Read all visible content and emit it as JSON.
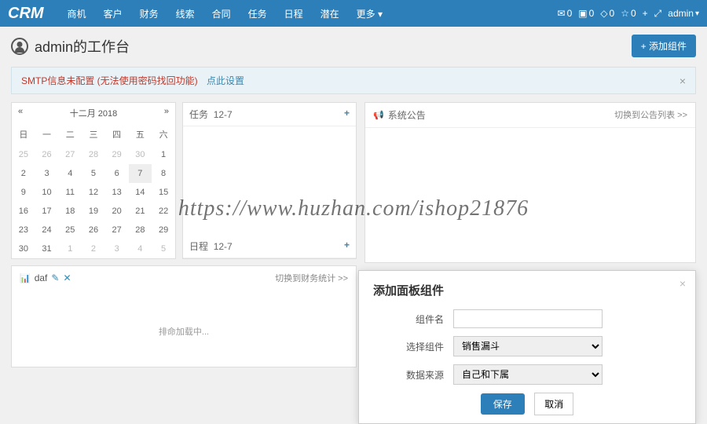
{
  "brand": "CRM",
  "nav": [
    "商机",
    "客户",
    "财务",
    "线索",
    "合同",
    "任务",
    "日程",
    "潜在",
    "更多"
  ],
  "topRight": {
    "mail": "0",
    "chat": "0",
    "diamond": "0",
    "star": "0",
    "user": "admin"
  },
  "page": {
    "title": "admin的工作台",
    "addWidget": "+ 添加组件"
  },
  "alert": {
    "text": "SMTP信息未配置 (无法使用密码找回功能)",
    "link": "点此设置"
  },
  "calendar": {
    "title": "十二月 2018",
    "dow": [
      "日",
      "一",
      "二",
      "三",
      "四",
      "五",
      "六"
    ],
    "weeks": [
      [
        {
          "d": "25",
          "o": true
        },
        {
          "d": "26",
          "o": true
        },
        {
          "d": "27",
          "o": true
        },
        {
          "d": "28",
          "o": true
        },
        {
          "d": "29",
          "o": true
        },
        {
          "d": "30",
          "o": true
        },
        {
          "d": "1"
        }
      ],
      [
        {
          "d": "2"
        },
        {
          "d": "3"
        },
        {
          "d": "4"
        },
        {
          "d": "5"
        },
        {
          "d": "6"
        },
        {
          "d": "7",
          "t": true
        },
        {
          "d": "8"
        }
      ],
      [
        {
          "d": "9"
        },
        {
          "d": "10"
        },
        {
          "d": "11"
        },
        {
          "d": "12"
        },
        {
          "d": "13"
        },
        {
          "d": "14"
        },
        {
          "d": "15"
        }
      ],
      [
        {
          "d": "16"
        },
        {
          "d": "17"
        },
        {
          "d": "18"
        },
        {
          "d": "19"
        },
        {
          "d": "20"
        },
        {
          "d": "21"
        },
        {
          "d": "22"
        }
      ],
      [
        {
          "d": "23"
        },
        {
          "d": "24"
        },
        {
          "d": "25"
        },
        {
          "d": "26"
        },
        {
          "d": "27"
        },
        {
          "d": "28"
        },
        {
          "d": "29"
        }
      ],
      [
        {
          "d": "30"
        },
        {
          "d": "31"
        },
        {
          "d": "1",
          "o": true
        },
        {
          "d": "2",
          "o": true
        },
        {
          "d": "3",
          "o": true
        },
        {
          "d": "4",
          "o": true
        },
        {
          "d": "5",
          "o": true
        }
      ]
    ]
  },
  "tasks": {
    "title": "任务",
    "date": "12-7",
    "schedule": "日程",
    "scheduleDate": "12-7"
  },
  "announce": {
    "title": "系统公告",
    "switch": "切换到公告列表 >>"
  },
  "daf": {
    "title": "daf",
    "switch": "切换到财务统计 >>",
    "loading": "排命加载中..."
  },
  "modal": {
    "title": "添加面板组件",
    "labels": {
      "name": "组件名",
      "select": "选择组件",
      "source": "数据来源"
    },
    "selectValue": "销售漏斗",
    "sourceValue": "自己和下属",
    "save": "保存",
    "cancel": "取消"
  },
  "watermark": "https://www.huzhan.com/ishop21876"
}
